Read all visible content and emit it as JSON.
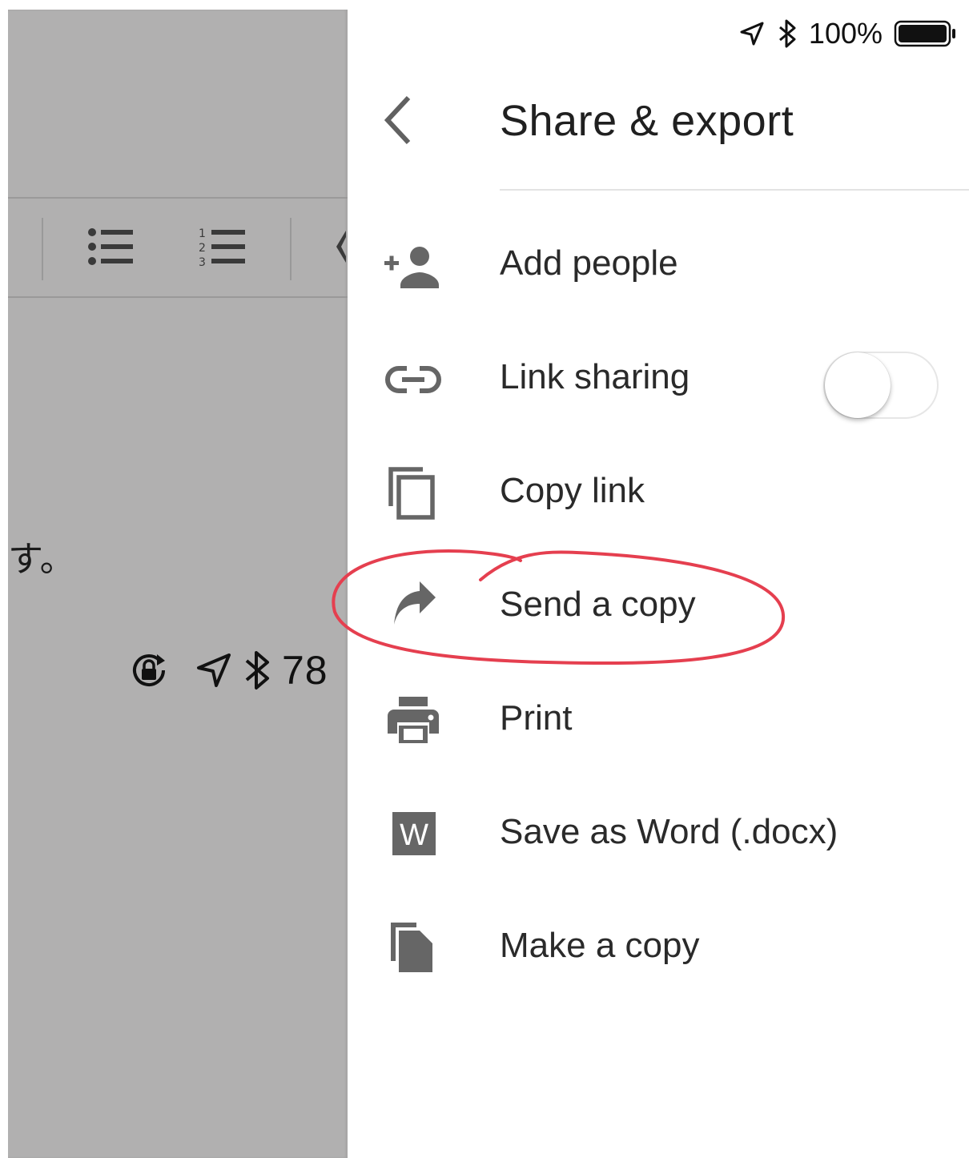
{
  "background_doc": {
    "text_fragment": "す。",
    "status_battery_percent": "78",
    "icons": [
      "bulleted-list-icon",
      "numbered-list-icon",
      "rotation-lock-icon",
      "location-arrow-icon",
      "bluetooth-icon"
    ]
  },
  "status_bar": {
    "battery_percent": "100%",
    "icons": [
      "location-arrow-icon",
      "bluetooth-icon",
      "battery-icon"
    ]
  },
  "header": {
    "title": "Share & export",
    "back_icon": "chevron-left-icon"
  },
  "menu": {
    "items": [
      {
        "label": "Add people",
        "icon": "add-person-icon"
      },
      {
        "label": "Link sharing",
        "icon": "link-icon",
        "toggle_on": false
      },
      {
        "label": "Copy link",
        "icon": "copy-icon"
      },
      {
        "label": "Send a copy",
        "icon": "share-arrow-icon",
        "highlighted": true
      },
      {
        "label": "Print",
        "icon": "printer-icon"
      },
      {
        "label": "Save as Word (.docx)",
        "icon": "word-icon",
        "icon_letter": "W"
      },
      {
        "label": "Make a copy",
        "icon": "file-copy-icon"
      }
    ]
  },
  "colors": {
    "icon_gray": "#666666",
    "dim_overlay": "#b1b0b0",
    "annotation_red": "#e53f4f"
  }
}
